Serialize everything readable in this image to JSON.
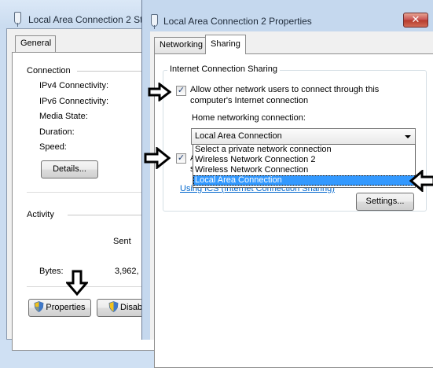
{
  "status_window": {
    "title": "Local Area Connection 2 St",
    "tab_general": "General",
    "connection_heading": "Connection",
    "ipv4_label": "IPv4 Connectivity:",
    "ipv6_label": "IPv6 Connectivity:",
    "media_state_label": "Media State:",
    "duration_label": "Duration:",
    "speed_label": "Speed:",
    "details_button": "Details...",
    "activity_heading": "Activity",
    "sent_label": "Sent",
    "bytes_label": "Bytes:",
    "bytes_sent_value": "3,962,",
    "properties_button": "Properties",
    "disable_button": "Disab"
  },
  "properties_window": {
    "title": "Local Area Connection 2 Properties",
    "close_glyph": "✕",
    "tabs": [
      {
        "label": "Networking",
        "active": false
      },
      {
        "label": "Sharing",
        "active": true
      }
    ],
    "ics_group_label": "Internet Connection Sharing",
    "allow_checkbox_line1": "Allow other network users to connect through this",
    "allow_checkbox_line2": "computer's Internet connection",
    "allow_checked": true,
    "home_network_label": "Home networking connection:",
    "selected_connection": "Local Area Connection",
    "dropdown_options": [
      "Select a private network connection",
      "Wireless Network Connection 2",
      "Wireless Network Connection",
      "Local Area Connection"
    ],
    "selected_index": 3,
    "second_checkbox_checked": true,
    "second_checkbox_partial": "A",
    "second_checkbox_line2_partial": "s",
    "ics_link": "Using ICS (Internet Connection Sharing)",
    "settings_button": "Settings..."
  },
  "colors": {
    "highlight": "#3399ff",
    "link": "#0066cc",
    "close_button": "#c75050"
  }
}
